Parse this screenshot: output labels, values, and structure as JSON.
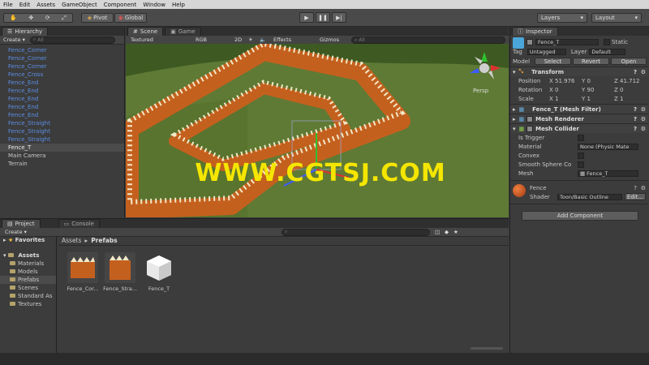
{
  "menu": [
    "File",
    "Edit",
    "Assets",
    "GameObject",
    "Component",
    "Window",
    "Help"
  ],
  "toolbar": {
    "pivot": "Pivot",
    "global": "Global",
    "layers": "Layers",
    "layout": "Layout"
  },
  "hierarchy": {
    "tab": "Hierarchy",
    "create": "Create",
    "search": "All",
    "items": [
      {
        "label": "Fence_Corner",
        "type": "prefab"
      },
      {
        "label": "Fence_Corner",
        "type": "prefab"
      },
      {
        "label": "Fence_Corner",
        "type": "prefab"
      },
      {
        "label": "Fence_Cross",
        "type": "prefab"
      },
      {
        "label": "Fence_End",
        "type": "prefab"
      },
      {
        "label": "Fence_End",
        "type": "prefab"
      },
      {
        "label": "Fence_End",
        "type": "prefab"
      },
      {
        "label": "Fence_End",
        "type": "prefab"
      },
      {
        "label": "Fence_End",
        "type": "prefab"
      },
      {
        "label": "Fence_Straight",
        "type": "prefab"
      },
      {
        "label": "Fence_Straight",
        "type": "prefab"
      },
      {
        "label": "Fence_Straight",
        "type": "prefab"
      },
      {
        "label": "Fence_T",
        "type": "selected"
      },
      {
        "label": "Main Camera",
        "type": "normal"
      },
      {
        "label": "Terrain",
        "type": "normal"
      }
    ]
  },
  "scene": {
    "tab_scene": "Scene",
    "tab_game": "Game",
    "textured": "Textured",
    "rgb": "RGB",
    "mode2d": "2D",
    "effects": "Effects",
    "gizmos": "Gizmos",
    "search": "All",
    "persp": "Persp",
    "watermark": "WWW.CGTSJ.COM"
  },
  "inspector": {
    "tab": "Inspector",
    "object_name": "Fence_T",
    "static": "Static",
    "tag_label": "Tag",
    "tag_value": "Untagged",
    "layer_label": "Layer",
    "layer_value": "Default",
    "model_label": "Model",
    "select": "Select",
    "revert": "Revert",
    "open": "Open",
    "transform": "Transform",
    "position_label": "Position",
    "position": {
      "x": "X 51.976",
      "y": "Y 0",
      "z": "Z 41.712"
    },
    "rotation_label": "Rotation",
    "rotation": {
      "x": "X 0",
      "y": "Y 90",
      "z": "Z 0"
    },
    "scale_label": "Scale",
    "scale": {
      "x": "X 1",
      "y": "Y 1",
      "z": "Z 1"
    },
    "mesh_filter": "Fence_T (Mesh Filter)",
    "mesh_renderer": "Mesh Renderer",
    "mesh_collider": "Mesh Collider",
    "is_trigger": "Is Trigger",
    "material_label": "Material",
    "material_value": "None (Physic Mate",
    "convex": "Convex",
    "smooth": "Smooth Sphere Co",
    "mesh_label": "Mesh",
    "mesh_value": "Fence_T",
    "fence_material": "Fence",
    "shader_label": "Shader",
    "shader_value": "Toon/Basic Outline",
    "edit": "Edit...",
    "add_component": "Add Component"
  },
  "project": {
    "tab_project": "Project",
    "tab_console": "Console",
    "create": "Create",
    "favorites": "Favorites",
    "assets_root": "Assets",
    "folders": [
      "Materials",
      "Models",
      "Prefabs",
      "Scenes",
      "Standard As",
      "Textures"
    ],
    "breadcrumb_root": "Assets",
    "breadcrumb_current": "Prefabs",
    "assets": [
      "Fence_Cor...",
      "Fence_Stra...",
      "Fence_T"
    ]
  }
}
